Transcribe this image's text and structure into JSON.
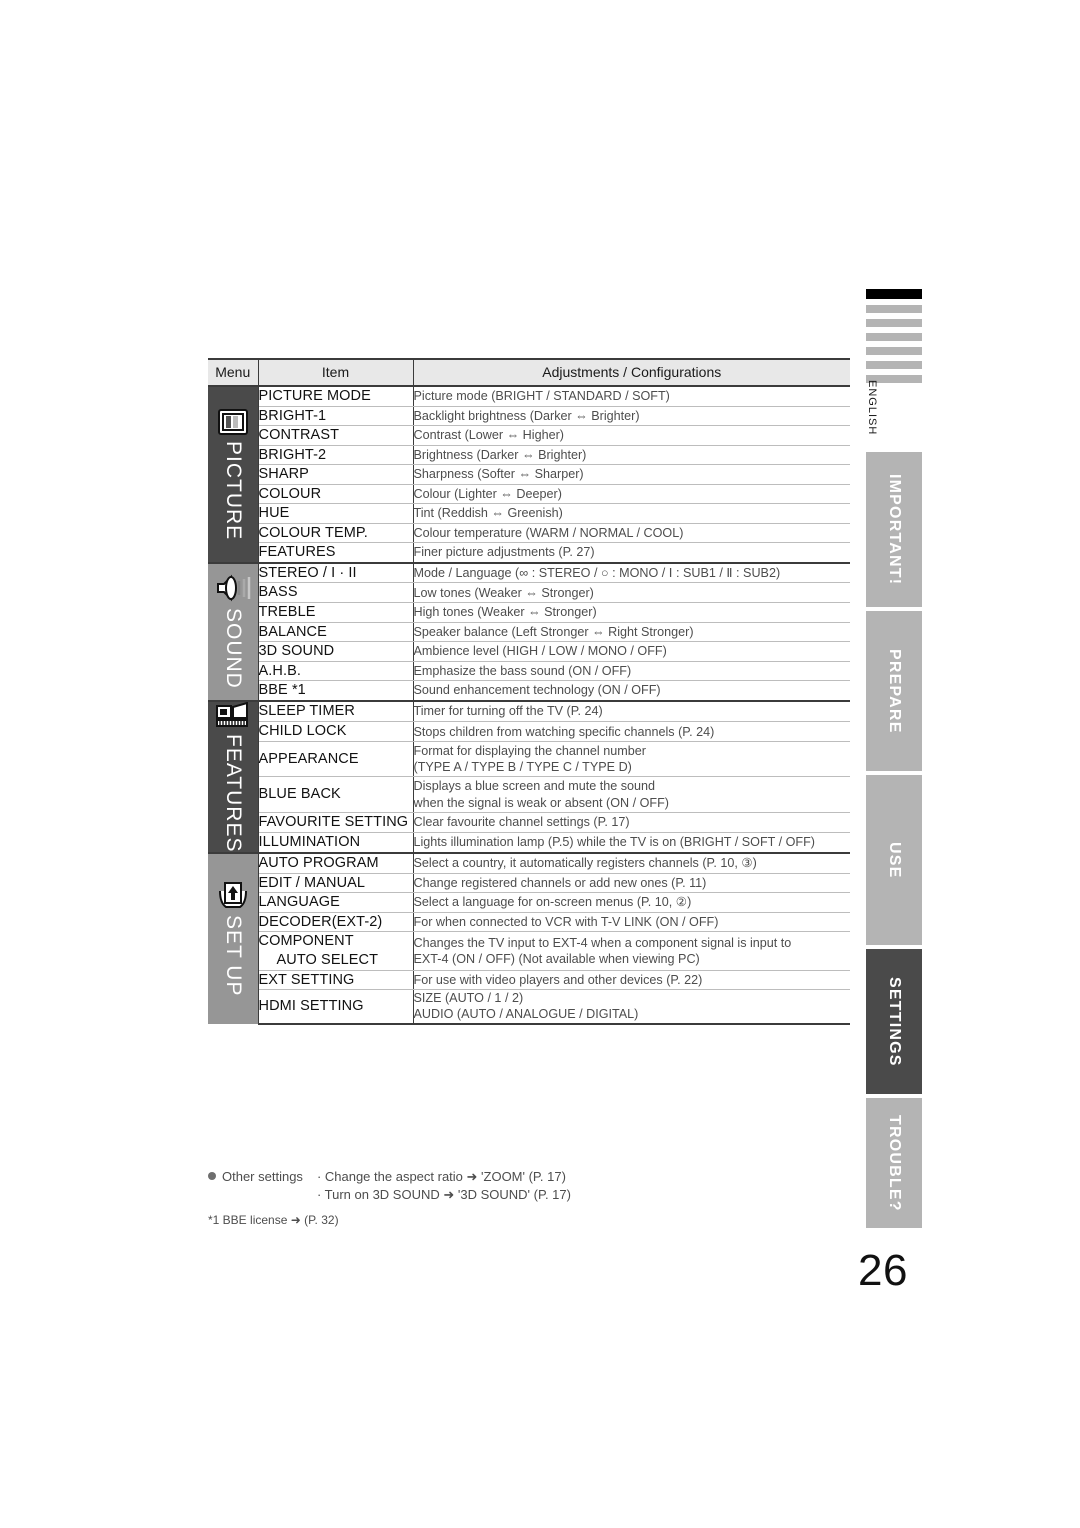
{
  "document": {
    "language_label": "ENGLISH",
    "page_number": "26"
  },
  "table": {
    "headers": {
      "menu": "Menu",
      "item": "Item",
      "adjustments": "Adjustments / Configurations"
    },
    "groups": [
      {
        "name": "PICTURE",
        "icon": "picture-screen-icon",
        "shade": "dark",
        "rows": [
          {
            "item": "PICTURE MODE",
            "adj": "Picture mode (BRIGHT / STANDARD / SOFT)"
          },
          {
            "item": "BRIGHT-1",
            "adj": "Backlight brightness (Darker ⇔ Brighter)"
          },
          {
            "item": "CONTRAST",
            "adj": "Contrast (Lower ⇔ Higher)"
          },
          {
            "item": "BRIGHT-2",
            "adj": "Brightness (Darker ⇔ Brighter)"
          },
          {
            "item": "SHARP",
            "adj": "Sharpness (Softer ⇔ Sharper)"
          },
          {
            "item": "COLOUR",
            "adj": "Colour (Lighter ⇔ Deeper)"
          },
          {
            "item": "HUE",
            "adj": "Tint (Reddish ⇔ Greenish)"
          },
          {
            "item": "COLOUR TEMP.",
            "adj": "Colour temperature (WARM / NORMAL / COOL)"
          },
          {
            "item": "FEATURES",
            "adj": "Finer picture adjustments (P. 27)"
          }
        ]
      },
      {
        "name": "SOUND",
        "icon": "speaker-icon",
        "shade": "light",
        "rows": [
          {
            "item": "STEREO / I · II",
            "adj": "Mode / Language (∞ : STEREO / ○ : MONO / Ⅰ : SUB1 / Ⅱ : SUB2)"
          },
          {
            "item": "BASS",
            "adj": "Low tones (Weaker ⇔ Stronger)"
          },
          {
            "item": "TREBLE",
            "adj": "High tones (Weaker ⇔ Stronger)"
          },
          {
            "item": "BALANCE",
            "adj": "Speaker balance (Left Stronger ⇔ Right Stronger)"
          },
          {
            "item": "3D SOUND",
            "adj": "Ambience level (HIGH / LOW / MONO / OFF)"
          },
          {
            "item": "A.H.B.",
            "adj": "Emphasize the bass sound (ON / OFF)"
          },
          {
            "item": "BBE *1",
            "adj": "Sound enhancement technology (ON / OFF)"
          }
        ]
      },
      {
        "name": "FEATURES",
        "icon": "features-panel-icon",
        "shade": "dark",
        "rows": [
          {
            "item": "SLEEP TIMER",
            "adj": "Timer for turning off the TV (P. 24)"
          },
          {
            "item": "CHILD LOCK",
            "adj": "Stops children from watching specific channels (P. 24)"
          },
          {
            "item": "APPEARANCE",
            "adj": "Format for displaying the channel number\n(TYPE A / TYPE B / TYPE C / TYPE D)"
          },
          {
            "item": "BLUE BACK",
            "adj": "Displays a blue screen and mute the sound\nwhen the signal is weak or absent (ON / OFF)"
          },
          {
            "item": "FAVOURITE SETTING",
            "adj": "Clear favourite channel settings (P. 17)"
          },
          {
            "item": "ILLUMINATION",
            "adj": "Lights illumination lamp (P.5) while the TV is on (BRIGHT / SOFT / OFF)"
          }
        ]
      },
      {
        "name": "SET UP",
        "icon": "setup-arrow-icon",
        "shade": "light",
        "rows": [
          {
            "item": "AUTO PROGRAM",
            "adj": "Select a country, it automatically registers channels (P. 10, ③)"
          },
          {
            "item": "EDIT / MANUAL",
            "adj": "Change registered channels or add new ones (P. 11)"
          },
          {
            "item": "LANGUAGE",
            "adj": "Select a language for on-screen menus (P. 10, ②)"
          },
          {
            "item": "DECODER(EXT-2)",
            "adj": "For when connected to VCR with T-V LINK (ON / OFF)"
          },
          {
            "item": "COMPONENT\n   AUTO SELECT",
            "adj": "Changes the TV input to EXT-4 when a component signal is input to\nEXT-4 (ON / OFF) (Not available when viewing PC)"
          },
          {
            "item": "EXT SETTING",
            "adj": "For use with video players and other devices (P. 22)"
          },
          {
            "item": "HDMI SETTING",
            "adj": "SIZE (AUTO / 1 / 2)\nAUDIO (AUTO / ANALOGUE / DIGITAL)"
          }
        ]
      }
    ]
  },
  "footnotes": {
    "other_settings_label": "Other settings",
    "lines": [
      "· Change the aspect ratio ➜ 'ZOOM' (P. 17)",
      "· Turn on 3D SOUND ➜ '3D SOUND' (P. 17)"
    ],
    "bbe_note": "*1 BBE license ➜ (P. 32)"
  },
  "side_tabs": [
    {
      "label": "IMPORTANT!",
      "active": false
    },
    {
      "label": "PREPARE",
      "active": false
    },
    {
      "label": "USE",
      "active": false
    },
    {
      "label": "SETTINGS",
      "active": true
    },
    {
      "label": "TROUBLE?",
      "active": false
    }
  ],
  "colors": {
    "dark_group": "#4a4a4a",
    "light_group": "#969696",
    "tab_inactive": "#b4b4b4",
    "tab_active": "#4a4a4a",
    "header_bg": "#e8e8e8"
  }
}
